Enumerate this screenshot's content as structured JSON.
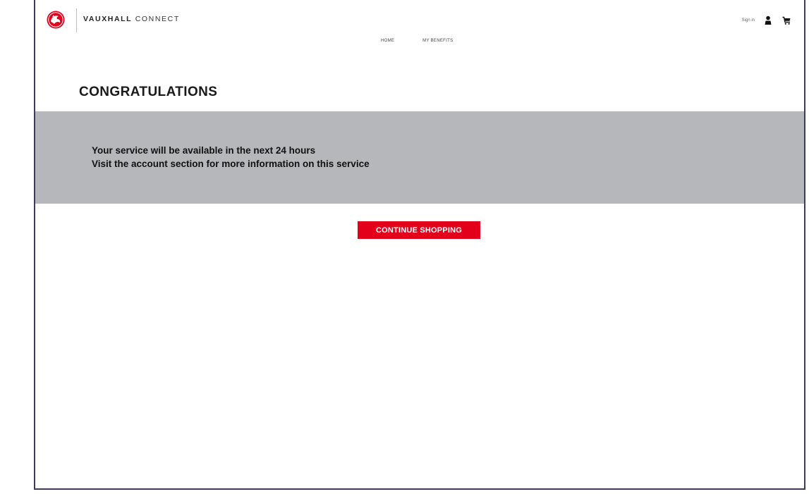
{
  "brand": {
    "name_bold": "VAUXHALL",
    "name_light": "CONNECT"
  },
  "nav": {
    "items": [
      {
        "label": "HOME"
      },
      {
        "label": "MY BENEFITS"
      }
    ]
  },
  "utility": {
    "signin_label": "Sign in",
    "user_icon": "user-icon",
    "cart_icon": "cart-icon"
  },
  "page": {
    "title": "CONGRATULATIONS"
  },
  "banner": {
    "line1": "Your service will be available in the next 24 hours",
    "line2": "Visit the account section for more information on this service"
  },
  "cta": {
    "label": "CONTINUE SHOPPING"
  },
  "colors": {
    "accent": "#e2001a",
    "banner_bg": "#b5b7ba",
    "frame_border": "#3d3a5c"
  }
}
